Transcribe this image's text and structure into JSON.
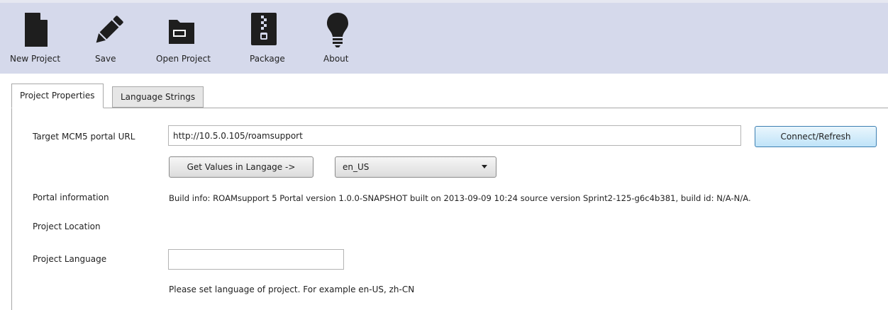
{
  "toolbar": {
    "items": [
      {
        "label": "New Project",
        "icon": "new-file-icon"
      },
      {
        "label": "Save",
        "icon": "pencil-icon"
      },
      {
        "label": "Open Project",
        "icon": "folder-icon"
      },
      {
        "label": "Package",
        "icon": "zip-icon"
      },
      {
        "label": "About",
        "icon": "lightbulb-icon"
      }
    ]
  },
  "tabs": [
    {
      "label": "Project Properties",
      "active": true
    },
    {
      "label": "Language Strings",
      "active": false
    }
  ],
  "form": {
    "portal_url": {
      "label": "Target MCM5 portal URL",
      "value": "http://10.5.0.105/roamsupport"
    },
    "connect_button": "Connect/Refresh",
    "get_values_button": "Get Values in Langage ->",
    "language_select": {
      "selected": "en_US"
    },
    "portal_information": {
      "label": "Portal information",
      "value": "Build info: ROAMsupport 5 Portal version 1.0.0-SNAPSHOT built on 2013-09-09 10:24 source version Sprint2-125-g6c4b381, build id: N/A-N/A."
    },
    "project_location": {
      "label": "Project Location"
    },
    "project_language": {
      "label": "Project Language",
      "value": "",
      "hint": "Please set language of project. For example en-US, zh-CN"
    }
  },
  "colors": {
    "toolbar_bg": "#d5d9eb",
    "icon": "#1e1e1e",
    "primary_button_border": "#3c7fb1"
  }
}
